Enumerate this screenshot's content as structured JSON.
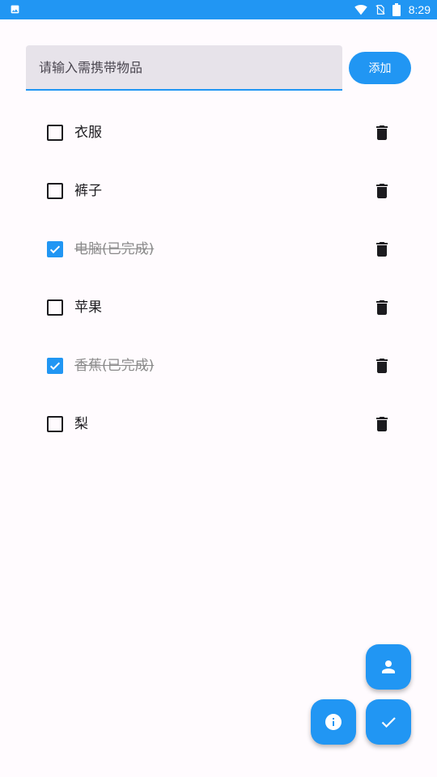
{
  "status_bar": {
    "time": "8:29",
    "left_icon": "image-icon",
    "icons": [
      "wifi-icon",
      "no-sim-icon",
      "battery-icon"
    ]
  },
  "input": {
    "placeholder": "请输入需携带物品",
    "value": ""
  },
  "add_button": {
    "label": "添加"
  },
  "items": [
    {
      "label": "衣服",
      "checked": false
    },
    {
      "label": "裤子",
      "checked": false
    },
    {
      "label": "电脑(已完成)",
      "checked": true
    },
    {
      "label": "苹果",
      "checked": false
    },
    {
      "label": "香蕉(已完成)",
      "checked": true
    },
    {
      "label": "梨",
      "checked": false
    }
  ],
  "fabs": [
    {
      "icon": "person-icon"
    },
    {
      "icon": "info-icon"
    },
    {
      "icon": "check-icon"
    }
  ],
  "colors": {
    "primary": "#2196f3",
    "background": "#fffbfe",
    "input_fill": "#e7e3ea",
    "text": "#1c1b1f",
    "completed_text": "#8a8a8a"
  }
}
